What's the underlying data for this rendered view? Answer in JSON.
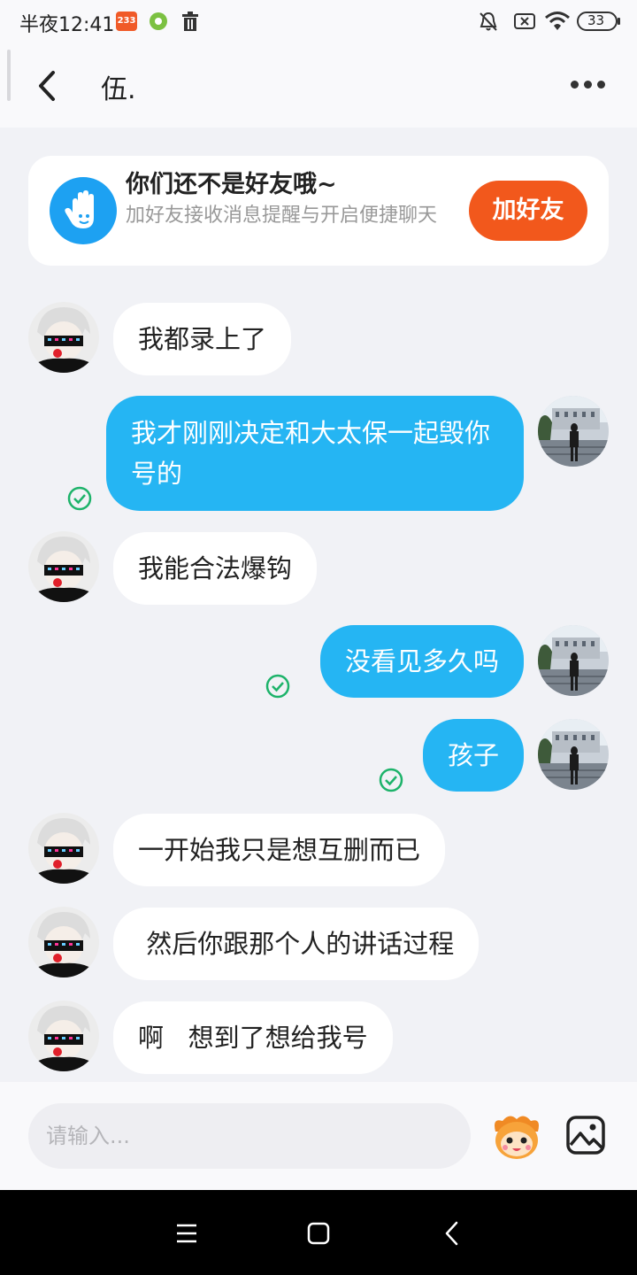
{
  "status_bar": {
    "time": "半夜12:41",
    "badge": "233",
    "battery": "33"
  },
  "header": {
    "title": "伍."
  },
  "friend_card": {
    "title": "你们还不是好友哦~",
    "description": "加好友接收消息提醒与开启便捷聊天",
    "button": "加好友"
  },
  "messages": [
    {
      "side": "in",
      "text": "我都录上了"
    },
    {
      "side": "out",
      "text": "我才刚刚决定和大太保一起毁你号的",
      "read": true
    },
    {
      "side": "in",
      "text": "我能合法爆钩"
    },
    {
      "side": "out",
      "text": "没看见多久吗",
      "read": true
    },
    {
      "side": "out",
      "text": "孩子",
      "read": true
    },
    {
      "side": "in",
      "text": "一开始我只是想互删而已"
    },
    {
      "side": "in",
      "text": " 然后你跟那个人的讲话过程"
    },
    {
      "side": "in",
      "text": "啊   想到了想给我号"
    }
  ],
  "composer": {
    "placeholder": "请输入..."
  },
  "colors": {
    "outgoing_bubble": "#25b5f3",
    "add_button": "#f2581c",
    "read_check": "#1db36a"
  }
}
